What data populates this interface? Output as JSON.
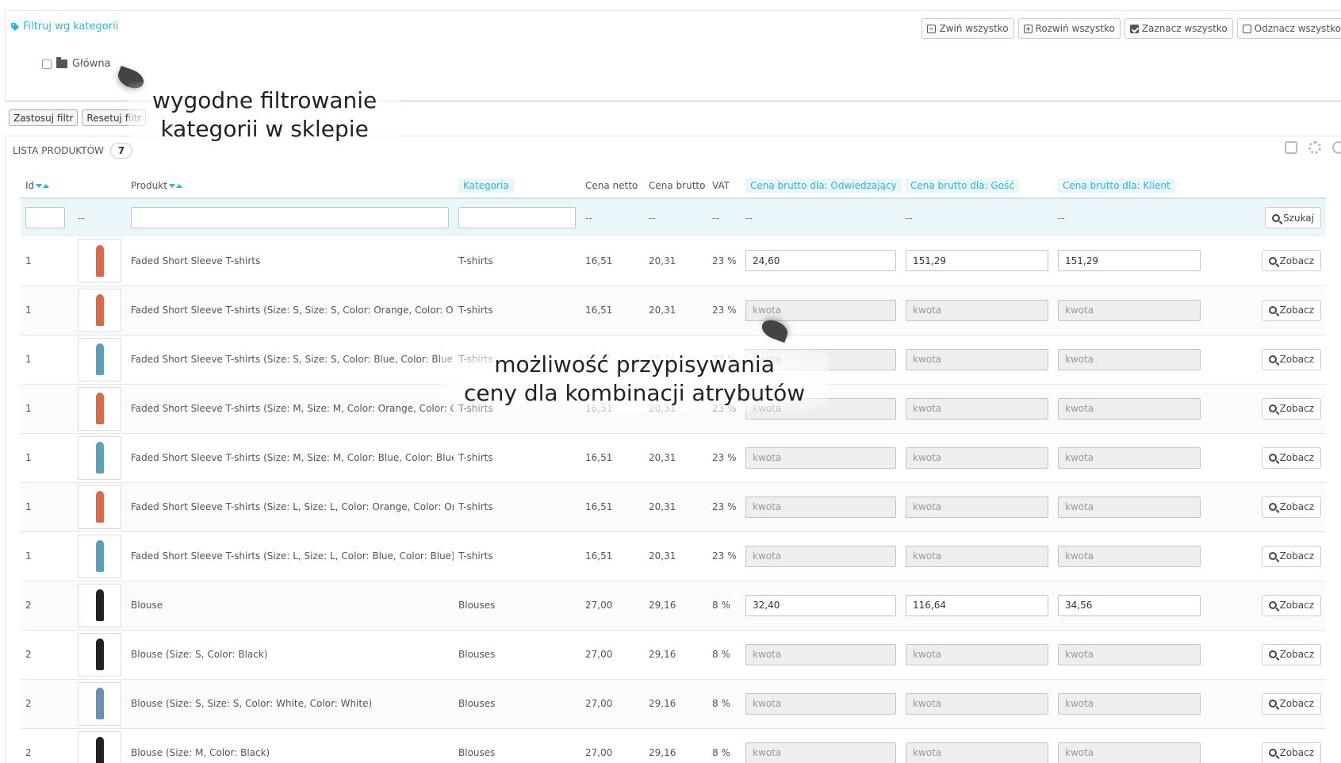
{
  "filter": {
    "title": "Filtruj wg kategorii",
    "collapse_all": "Zwiń wszystko",
    "expand_all": "Rozwiń wszystko",
    "select_all": "Zaznacz wszystko",
    "deselect_all": "Odznacz wszystko",
    "tree_root": "Główna",
    "apply": "Zastosuj filtr",
    "reset": "Resetuj filtr"
  },
  "list": {
    "title": "LISTA PRODUKTÓW",
    "count": "7",
    "columns": {
      "id": "Id",
      "product": "Produkt",
      "category": "Kategoria",
      "net": "Cena netto",
      "gross": "Cena brutto",
      "vat": "VAT",
      "price_visitor": "Cena brutto dla: Odwiedzający",
      "price_guest": "Cena brutto dla: Gość",
      "price_client": "Cena brutto dla: Klient"
    },
    "filter_dash": "--",
    "search_button": "Szukaj",
    "view_button": "Zobacz",
    "placeholder": "kwota",
    "rows": [
      {
        "id": "1",
        "name": "Faded Short Sleeve T-shirts",
        "category": "T-shirts",
        "net": "16,51",
        "gross": "20,31",
        "vat": "23 %",
        "p1": "24,60",
        "p2": "151,29",
        "p3": "151,29",
        "color": "#d86a4a"
      },
      {
        "id": "1",
        "name": "Faded Short Sleeve T-shirts (Size: S, Size: S, Color: Orange, Color: Orange)",
        "category": "T-shirts",
        "net": "16,51",
        "gross": "20,31",
        "vat": "23 %",
        "p1": "",
        "p2": "",
        "p3": "",
        "color": "#d86a4a"
      },
      {
        "id": "1",
        "name": "Faded Short Sleeve T-shirts (Size: S, Size: S, Color: Blue, Color: Blue)",
        "category": "T-shirts",
        "net": "16,51",
        "gross": "20,31",
        "vat": "23 %",
        "p1": "",
        "p2": "",
        "p3": "",
        "color": "#5aa0b8"
      },
      {
        "id": "1",
        "name": "Faded Short Sleeve T-shirts (Size: M, Size: M, Color: Orange, Color: Orange)",
        "category": "T-shirts",
        "net": "16,51",
        "gross": "20,31",
        "vat": "23 %",
        "p1": "",
        "p2": "",
        "p3": "",
        "color": "#d86a4a"
      },
      {
        "id": "1",
        "name": "Faded Short Sleeve T-shirts (Size: M, Size: M, Color: Blue, Color: Blue)",
        "category": "T-shirts",
        "net": "16,51",
        "gross": "20,31",
        "vat": "23 %",
        "p1": "",
        "p2": "",
        "p3": "",
        "color": "#5aa0b8"
      },
      {
        "id": "1",
        "name": "Faded Short Sleeve T-shirts (Size: L, Size: L, Color: Orange, Color: Orange)",
        "category": "T-shirts",
        "net": "16,51",
        "gross": "20,31",
        "vat": "23 %",
        "p1": "",
        "p2": "",
        "p3": "",
        "color": "#d86a4a"
      },
      {
        "id": "1",
        "name": "Faded Short Sleeve T-shirts (Size: L, Size: L, Color: Blue, Color: Blue)",
        "category": "T-shirts",
        "net": "16,51",
        "gross": "20,31",
        "vat": "23 %",
        "p1": "",
        "p2": "",
        "p3": "",
        "color": "#5aa0b8"
      },
      {
        "id": "2",
        "name": "Blouse",
        "category": "Blouses",
        "net": "27,00",
        "gross": "29,16",
        "vat": "8 %",
        "p1": "32,40",
        "p2": "116,64",
        "p3": "34,56",
        "color": "#222222"
      },
      {
        "id": "2",
        "name": "Blouse (Size: S, Color: Black)",
        "category": "Blouses",
        "net": "27,00",
        "gross": "29,16",
        "vat": "8 %",
        "p1": "",
        "p2": "",
        "p3": "",
        "color": "#222222"
      },
      {
        "id": "2",
        "name": "Blouse (Size: S, Size: S, Color: White, Color: White)",
        "category": "Blouses",
        "net": "27,00",
        "gross": "29,16",
        "vat": "8 %",
        "p1": "",
        "p2": "",
        "p3": "",
        "color": "#6a8fb8"
      },
      {
        "id": "2",
        "name": "Blouse (Size: M, Color: Black)",
        "category": "Blouses",
        "net": "27,00",
        "gross": "29,16",
        "vat": "8 %",
        "p1": "",
        "p2": "",
        "p3": "",
        "color": "#222222"
      }
    ]
  },
  "annotations": {
    "filter_note_line1": "wygodne filtrowanie",
    "filter_note_line2": "kategorii w sklepie",
    "combo_note_line1": "możliwość przypisywania",
    "combo_note_line2": "ceny dla kombinacji atrybutów"
  },
  "colors": {
    "accent": "#25b9d7",
    "filter_row_bg": "#eaf6fa"
  }
}
